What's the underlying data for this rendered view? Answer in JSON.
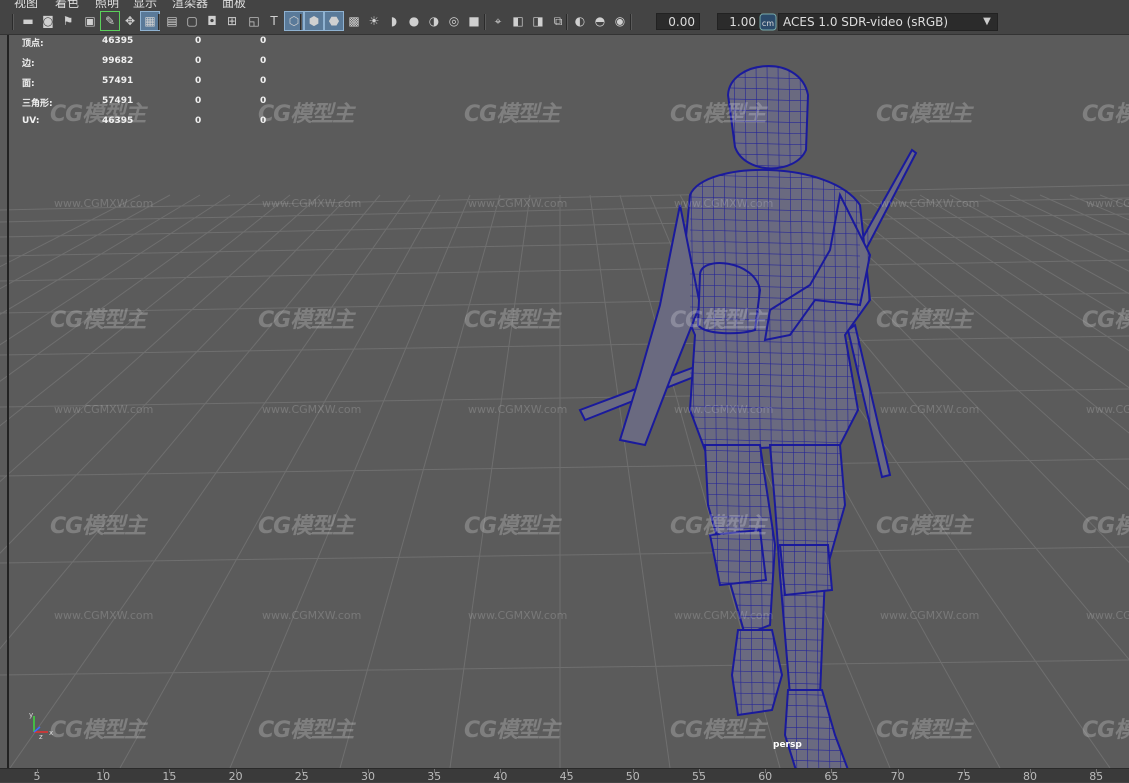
{
  "menu": [
    "视图",
    "着色",
    "照明",
    "显示",
    "渲染器",
    "面板"
  ],
  "toolbar": {
    "icons": [
      "camera-icon",
      "camera-attributes-icon",
      "bookmark-icon",
      "image-plane-icon",
      "grease-pencil-icon",
      "2d-pan-zoom-icon",
      "grid-icon",
      "film-gate-icon",
      "resolution-gate-icon",
      "gate-mask-icon",
      "field-chart-icon",
      "safe-action-icon",
      "safe-title-icon",
      "wireframe-icon",
      "smooth-shade-icon",
      "wireframe-on-shaded-icon",
      "textured-icon",
      "use-all-lights-icon",
      "shadows-icon",
      "screen-space-ao-icon",
      "motion-blur-icon",
      "anti-aliasing-icon",
      "depth-of-field-icon",
      "isolate-select-icon",
      "xray-icon",
      "xray-joints-icon",
      "backface-icon",
      "exposure-icon",
      "gamma-icon",
      "color-management-icon"
    ],
    "exposure_value": "0.00",
    "gamma_value": "1.00",
    "colorspace": "ACES 1.0 SDR-video (sRGB)"
  },
  "hud": [
    {
      "label": "顶点:",
      "a": "46395",
      "b": "0",
      "c": "0"
    },
    {
      "label": "边:",
      "a": "99682",
      "b": "0",
      "c": "0"
    },
    {
      "label": "面:",
      "a": "57491",
      "b": "0",
      "c": "0"
    },
    {
      "label": "三角形:",
      "a": "57491",
      "b": "0",
      "c": "0"
    },
    {
      "label": "UV:",
      "a": "46395",
      "b": "0",
      "c": "0"
    }
  ],
  "watermark": {
    "logo": "CG模型主",
    "url": "www.CGMXW.com"
  },
  "camera_label": "persp",
  "axis": {
    "y": "y",
    "x": "x",
    "z": "z"
  },
  "timeline": [
    "5",
    "10",
    "15",
    "20",
    "25",
    "30",
    "35",
    "40",
    "45",
    "50",
    "55",
    "60",
    "65",
    "70",
    "75",
    "80",
    "85"
  ],
  "colors": {
    "wire": "#1a1a9c",
    "bg": "#5b5b5b",
    "grid": "#6f6f6f",
    "accent": "#5bd05b"
  }
}
